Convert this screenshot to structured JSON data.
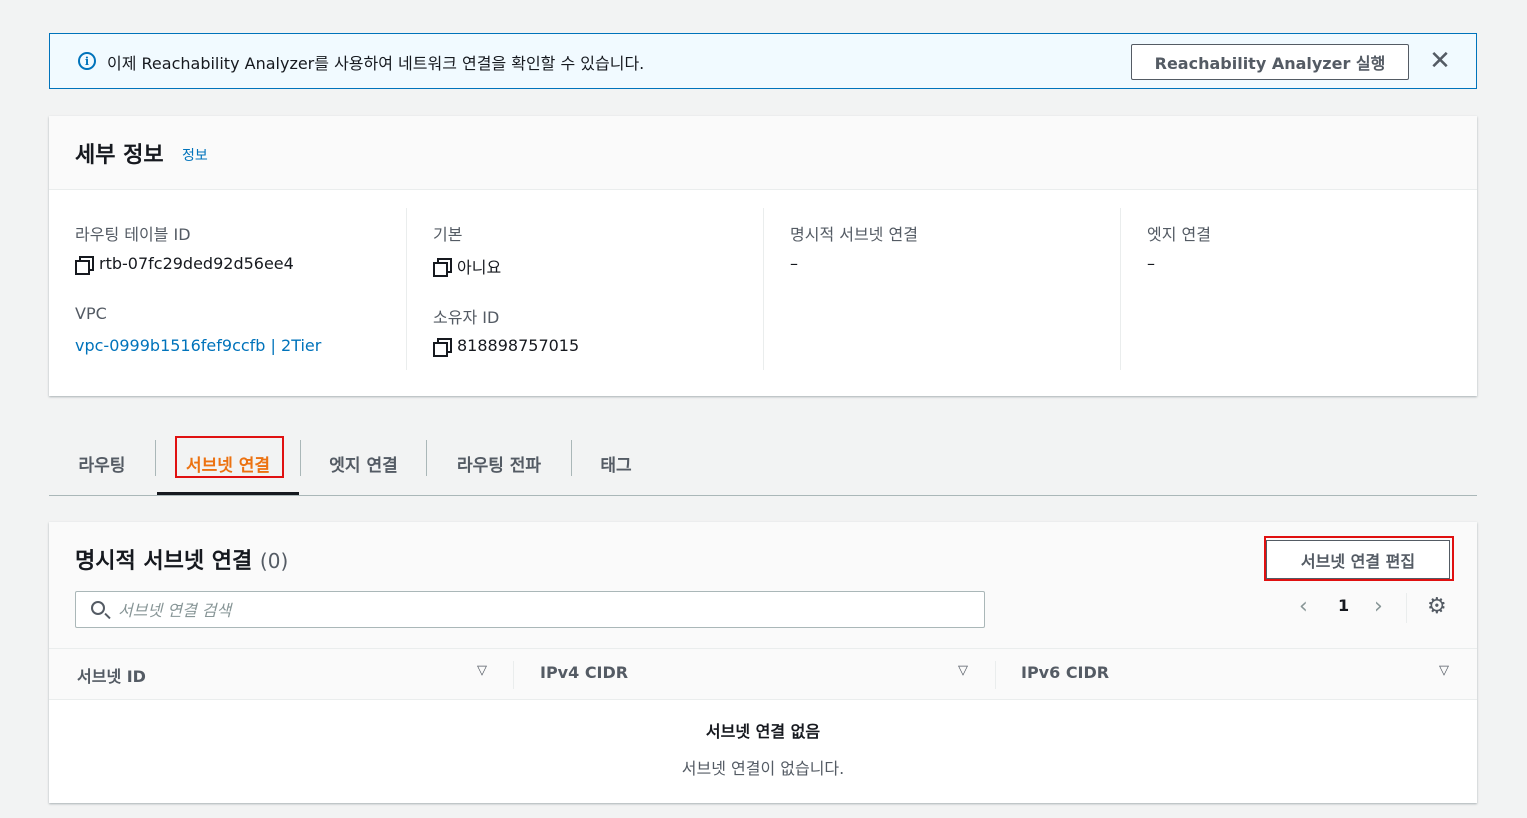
{
  "banner": {
    "message": "이제 Reachability Analyzer를 사용하여 네트워크 연결을 확인할 수 있습니다.",
    "button_label": "Reachability Analyzer 실행",
    "close_symbol": "✕"
  },
  "details": {
    "title": "세부 정보",
    "info_link": "정보",
    "fields": {
      "route_table_id_label": "라우팅 테이블 ID",
      "route_table_id_value": "rtb-07fc29ded92d56ee4",
      "vpc_label": "VPC",
      "vpc_value": "vpc-0999b1516fef9ccfb | 2Tier",
      "main_label": "기본",
      "main_value": "아니요",
      "owner_id_label": "소유자 ID",
      "owner_id_value": "818898757015",
      "explicit_subnet_label": "명시적 서브넷 연결",
      "explicit_subnet_value": "–",
      "edge_assoc_label": "엣지 연결",
      "edge_assoc_value": "–"
    }
  },
  "tabs": [
    {
      "label": "라우팅"
    },
    {
      "label": "서브넷 연결"
    },
    {
      "label": "엣지 연결"
    },
    {
      "label": "라우팅 전파"
    },
    {
      "label": "태그"
    }
  ],
  "active_tab_index": 1,
  "subnet_panel": {
    "title": "명시적 서브넷 연결",
    "count": "(0)",
    "edit_button": "서브넷 연결 편집",
    "search_placeholder": "서브넷 연결 검색",
    "pager": {
      "prev": "‹",
      "page": "1",
      "next": "›"
    },
    "settings_symbol": "⚙",
    "columns": [
      {
        "label": "서브넷 ID"
      },
      {
        "label": "IPv4 CIDR"
      },
      {
        "label": "IPv6 CIDR"
      }
    ],
    "sort_symbol": "▽",
    "empty_title": "서브넷 연결 없음",
    "empty_desc": "서브넷 연결이 없습니다."
  },
  "colors": {
    "accent": "#0073bb",
    "active_tab": "#ec7211",
    "highlight_box": "#e01010"
  }
}
